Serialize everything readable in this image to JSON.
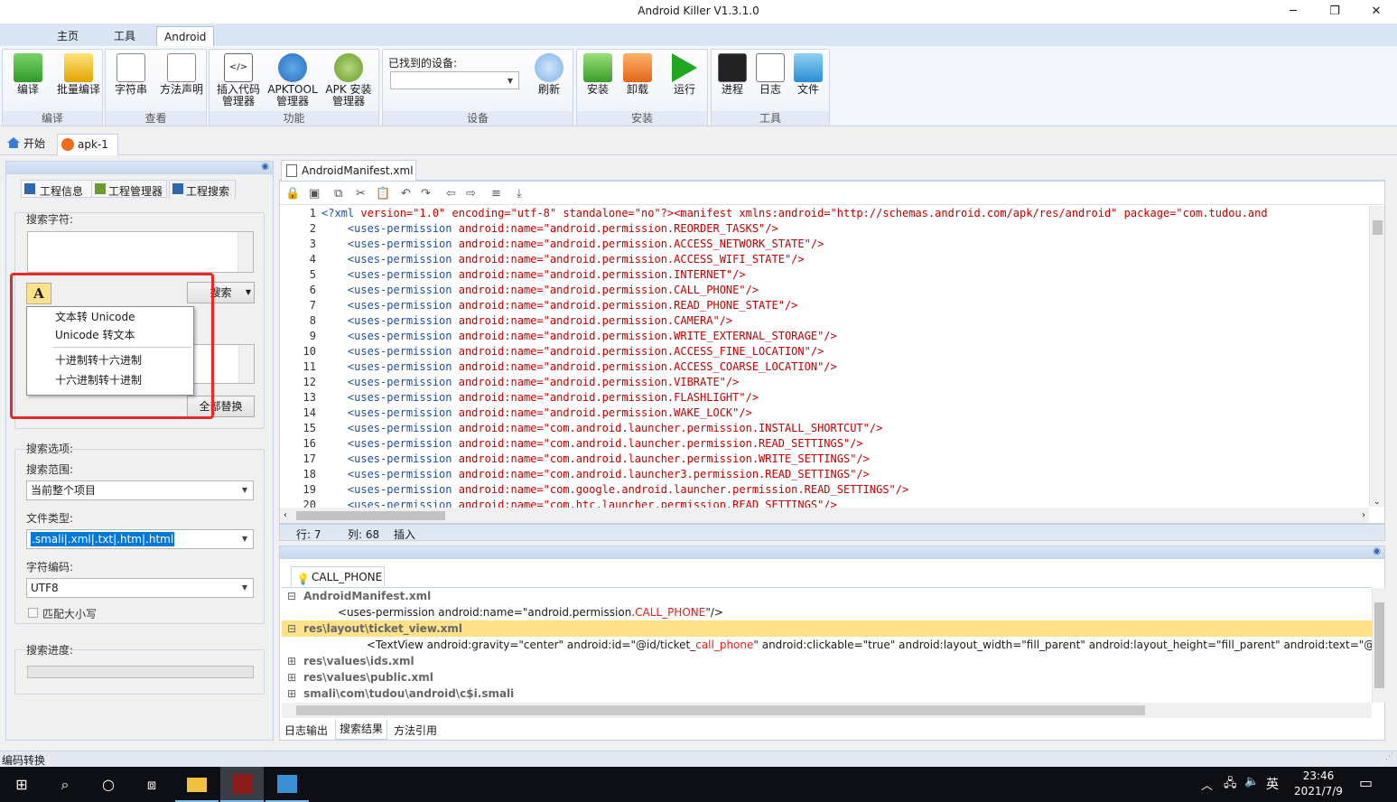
{
  "window": {
    "title": "Android Killer V1.3.1.0",
    "minimize": "─",
    "maximize": "❐",
    "close": "✕"
  },
  "ribbon_tabs": [
    "主页",
    "工具",
    "Android"
  ],
  "help_label": "?",
  "ribbon": {
    "groups": [
      {
        "label": "编译",
        "buttons": [
          "编译",
          "批量编译"
        ]
      },
      {
        "label": "查看",
        "buttons": [
          "字符串",
          "方法声明"
        ]
      },
      {
        "label": "功能",
        "buttons": [
          "插入代码管理器",
          "APKTOOL管理器",
          "APK 安装管理器"
        ]
      },
      {
        "label": "设备",
        "device_label": "已找到的设备:",
        "device_value": "",
        "buttons": [
          "刷新"
        ]
      },
      {
        "label": "安装",
        "buttons": [
          "安装",
          "卸载",
          "运行"
        ]
      },
      {
        "label": "工具",
        "buttons": [
          "进程",
          "日志",
          "文件"
        ]
      }
    ]
  },
  "doc_tabs": [
    "开始",
    "apk-1"
  ],
  "left_panel": {
    "tabs": [
      "工程信息",
      "工程管理器",
      "工程搜索"
    ],
    "search_label": "搜索字符:",
    "search_value": "",
    "search_button": "搜索",
    "replace_value": "",
    "replace_all_button": "全部替换",
    "options_label": "搜索选项:",
    "scope_label": "搜索范围:",
    "scope_value": "当前整个项目",
    "filetype_label": "文件类型:",
    "filetype_value": ".smali|.xml|.txt|.htm|.html",
    "encoding_label": "字符编码:",
    "encoding_value": "UTF8",
    "match_case_label": "匹配大小写",
    "progress_label": "搜索进度:"
  },
  "popup_menu": {
    "items": [
      "文本转 Unicode",
      "Unicode 转文本",
      "十进制转十六进制",
      "十六进制转十进制"
    ]
  },
  "editor": {
    "tab": "AndroidManifest.xml",
    "lines": [
      {
        "n": "1",
        "pre": "",
        "tag": "<?xml",
        "rest": " version=\"1.0\" encoding=\"utf-8\" standalone=\"no\"?><manifest xmlns:android=\"http://schemas.android.com/apk/res/android\" package=\"com.tudou.and"
      },
      {
        "n": "2",
        "pre": "    ",
        "tag": "<uses-permission",
        "rest": " android:name=\"android.permission.REORDER_TASKS\"/>"
      },
      {
        "n": "3",
        "pre": "    ",
        "tag": "<uses-permission",
        "rest": " android:name=\"android.permission.ACCESS_NETWORK_STATE\"/>"
      },
      {
        "n": "4",
        "pre": "    ",
        "tag": "<uses-permission",
        "rest": " android:name=\"android.permission.ACCESS_WIFI_STATE\"/>"
      },
      {
        "n": "5",
        "pre": "    ",
        "tag": "<uses-permission",
        "rest": " android:name=\"android.permission.INTERNET\"/>"
      },
      {
        "n": "6",
        "pre": "    ",
        "tag": "<uses-permission",
        "rest": " android:name=\"android.permission.CALL_PHONE\"/>"
      },
      {
        "n": "7",
        "pre": "    ",
        "tag": "<uses-permission",
        "rest": " android:name=\"android.permission.READ_PHONE_STATE\"/>"
      },
      {
        "n": "8",
        "pre": "    ",
        "tag": "<uses-permission",
        "rest": " android:name=\"android.permission.CAMERA\"/>"
      },
      {
        "n": "9",
        "pre": "    ",
        "tag": "<uses-permission",
        "rest": " android:name=\"android.permission.WRITE_EXTERNAL_STORAGE\"/>"
      },
      {
        "n": "10",
        "pre": "    ",
        "tag": "<uses-permission",
        "rest": " android:name=\"android.permission.ACCESS_FINE_LOCATION\"/>"
      },
      {
        "n": "11",
        "pre": "    ",
        "tag": "<uses-permission",
        "rest": " android:name=\"android.permission.ACCESS_COARSE_LOCATION\"/>"
      },
      {
        "n": "12",
        "pre": "    ",
        "tag": "<uses-permission",
        "rest": " android:name=\"android.permission.VIBRATE\"/>"
      },
      {
        "n": "13",
        "pre": "    ",
        "tag": "<uses-permission",
        "rest": " android:name=\"android.permission.FLASHLIGHT\"/>"
      },
      {
        "n": "14",
        "pre": "    ",
        "tag": "<uses-permission",
        "rest": " android:name=\"android.permission.WAKE_LOCK\"/>"
      },
      {
        "n": "15",
        "pre": "    ",
        "tag": "<uses-permission",
        "rest": " android:name=\"com.android.launcher.permission.INSTALL_SHORTCUT\"/>"
      },
      {
        "n": "16",
        "pre": "    ",
        "tag": "<uses-permission",
        "rest": " android:name=\"com.android.launcher.permission.READ_SETTINGS\"/>"
      },
      {
        "n": "17",
        "pre": "    ",
        "tag": "<uses-permission",
        "rest": " android:name=\"com.android.launcher.permission.WRITE_SETTINGS\"/>"
      },
      {
        "n": "18",
        "pre": "    ",
        "tag": "<uses-permission",
        "rest": " android:name=\"com.android.launcher3.permission.READ_SETTINGS\"/>"
      },
      {
        "n": "19",
        "pre": "    ",
        "tag": "<uses-permission",
        "rest": " android:name=\"com.google.android.launcher.permission.READ_SETTINGS\"/>"
      },
      {
        "n": "20",
        "pre": "    ",
        "tag": "<uses-permission",
        "rest": " android:name=\"com.htc.launcher.permission.READ_SETTINGS\"/>"
      }
    ],
    "status": {
      "row": "行: 7",
      "col": "列: 68",
      "mode": "插入"
    }
  },
  "results": {
    "tab": "CALL_PHONE",
    "items": [
      {
        "type": "file",
        "text": "AndroidManifest.xml",
        "expand": "⊟"
      },
      {
        "type": "match",
        "pre": "<uses-permission android:name=\"android.permission.",
        "hit": "CALL_PHONE",
        "post": "\"/>"
      },
      {
        "type": "file",
        "text": "res\\layout\\ticket_view.xml",
        "expand": "⊟",
        "selected": true
      },
      {
        "type": "match",
        "pre": "<TextView android:gravity=\"center\" android:id=\"@id/ticket_",
        "hit": "call_phone",
        "post": "\" android:clickable=\"true\" android:layout_width=\"fill_parent\" android:layout_height=\"fill_parent\" android:text=\"@string/re"
      },
      {
        "type": "file",
        "text": "res\\values\\ids.xml",
        "expand": "⊞"
      },
      {
        "type": "file",
        "text": "res\\values\\public.xml",
        "expand": "⊞"
      },
      {
        "type": "file",
        "text": "smali\\com\\tudou\\android\\c$i.smali",
        "expand": "⊞"
      }
    ],
    "bottom_tabs": [
      "日志输出",
      "搜索结果",
      "方法引用"
    ]
  },
  "statusbar": {
    "text": "编码转换"
  },
  "taskbar": {
    "tray_lang": "英",
    "time": "23:46",
    "date": "2021/7/9"
  },
  "colors": {
    "accent": "#2f66b0",
    "highlight": "#fde28a",
    "red_box": "#e52a2a"
  }
}
